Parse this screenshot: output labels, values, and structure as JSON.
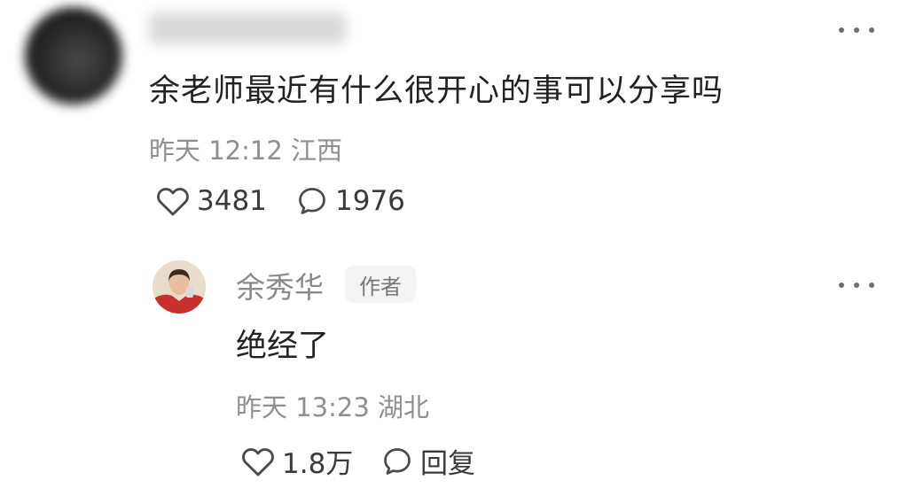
{
  "comment": {
    "text": "余老师最近有什么很开心的事可以分享吗",
    "time": "昨天 12:12",
    "location": "江西",
    "likes": "3481",
    "replies": "1976"
  },
  "reply": {
    "author_name": "余秀华",
    "author_badge": "作者",
    "text": "绝经了",
    "time": "昨天 13:23",
    "location": "湖北",
    "likes": "1.8万",
    "reply_label": "回复"
  },
  "icons": {
    "more": "more-icon",
    "like": "heart-icon",
    "comment": "comment-bubble-icon"
  },
  "colors": {
    "text_primary": "#222222",
    "text_secondary": "#8f8f8f",
    "badge_bg": "#f4f4f4"
  }
}
